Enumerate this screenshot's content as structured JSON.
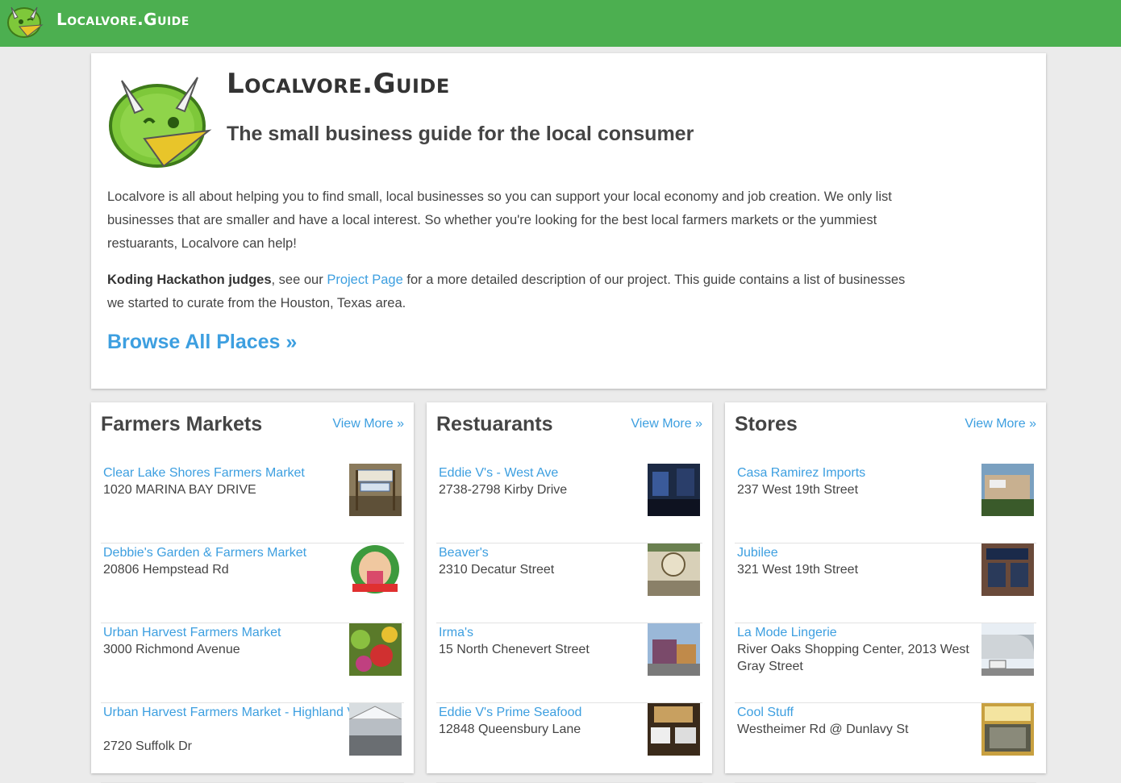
{
  "header": {
    "brand": "Localvore.Guide"
  },
  "hero": {
    "title": "Localvore.Guide",
    "tagline": "The small business guide for the local consumer",
    "intro": "Localvore is all about helping you to find small, local businesses so you can support your local economy and job creation. We only list businesses that are smaller and have a local interest. So whether you're looking for the best local farmers markets or the yummiest restuarants, Localvore can help!",
    "judges_strong": "Koding Hackathon judges",
    "judges_pre": ", see our ",
    "project_link": "Project Page",
    "judges_post": " for a more detailed description of our project. This guide contains a list of businesses we started to curate from the Houston, Texas area.",
    "browse": "Browse All Places »"
  },
  "columns": [
    {
      "title": "Farmers Markets",
      "more": "View More »",
      "items": [
        {
          "name": "Clear Lake Shores Farmers Market",
          "addr": "1020 MARINA BAY DRIVE"
        },
        {
          "name": "Debbie's Garden & Farmers Market",
          "addr": "20806 Hempstead Rd"
        },
        {
          "name": "Urban Harvest Farmers Market",
          "addr": "3000 Richmond Avenue"
        },
        {
          "name": "Urban Harvest Farmers Market - Highland Village",
          "addr": "2720 Suffolk Dr"
        }
      ]
    },
    {
      "title": "Restuarants",
      "more": "View More »",
      "items": [
        {
          "name": "Eddie V's - West Ave",
          "addr": "2738-2798 Kirby Drive"
        },
        {
          "name": "Beaver's",
          "addr": "2310 Decatur Street"
        },
        {
          "name": "Irma's",
          "addr": "15 North Chenevert Street"
        },
        {
          "name": "Eddie V's Prime Seafood",
          "addr": "12848 Queensbury Lane"
        }
      ]
    },
    {
      "title": "Stores",
      "more": "View More »",
      "items": [
        {
          "name": "Casa Ramirez Imports",
          "addr": "237 West 19th Street"
        },
        {
          "name": "Jubilee",
          "addr": "321 West 19th Street"
        },
        {
          "name": "La Mode Lingerie",
          "addr": "River Oaks Shopping Center, 2013 West Gray Street"
        },
        {
          "name": "Cool Stuff",
          "addr": "Westheimer Rd @ Dunlavy St"
        }
      ]
    }
  ]
}
